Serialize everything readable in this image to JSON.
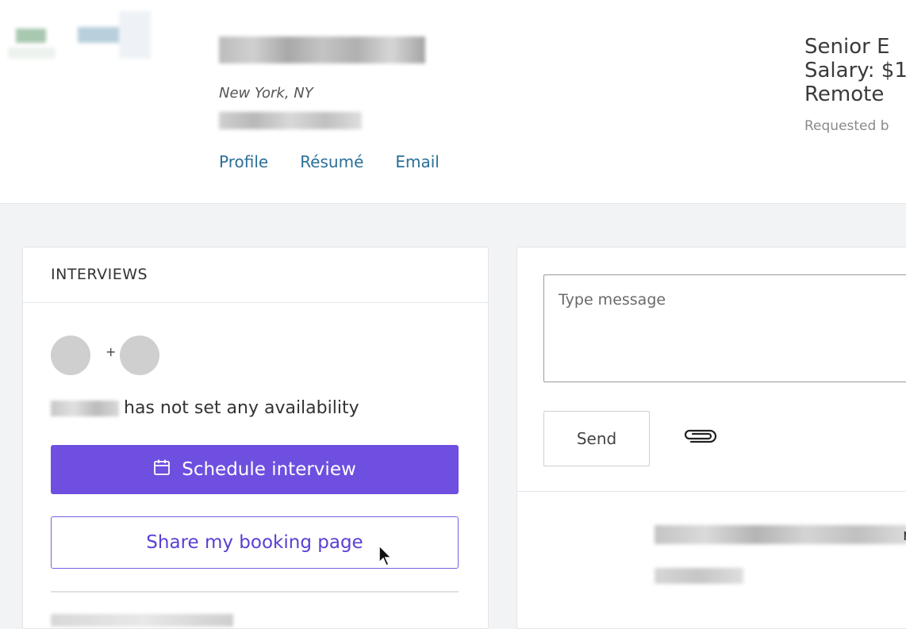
{
  "candidate": {
    "location": "New York, NY",
    "links": [
      "Profile",
      "Résumé",
      "Email"
    ]
  },
  "job": {
    "title_partial": "Senior E",
    "salary_partial": "Salary: $1",
    "work_type": "Remote",
    "requested_partial": "Requested b"
  },
  "interviews": {
    "title": "INTERVIEWS",
    "plus": "+",
    "availability_text": "has not set any availability",
    "schedule_label": "Schedule interview",
    "share_label": "Share my booking page"
  },
  "messages": {
    "placeholder": "Type message",
    "send_label": "Send",
    "trailing_char": "r"
  },
  "colors": {
    "primary": "#6e4fe0",
    "link": "#2a6f97",
    "background": "#f2f3f5"
  },
  "icons": [
    "calendar-icon",
    "paperclip-icon",
    "cursor-icon"
  ]
}
